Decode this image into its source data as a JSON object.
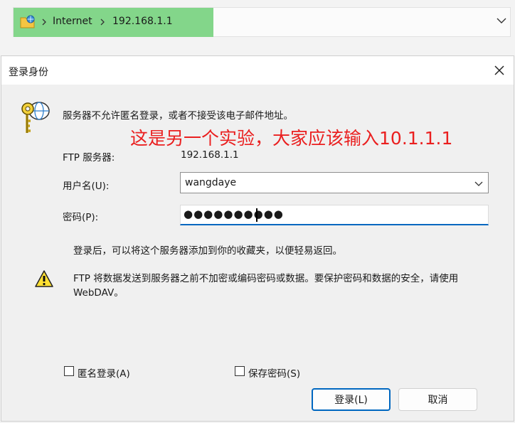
{
  "address_bar": {
    "crumbs": [
      "Internet",
      "192.168.1.1"
    ],
    "highlight_color": "#83d68a"
  },
  "dialog": {
    "title": "登录身份",
    "message": "服务器不允许匿名登录，或者不接受该电子邮件地址。",
    "annotation": "这是另一个实验，大家应该输入10.1.1.1",
    "annotation_color": "#ea1f1f",
    "ftp_server_label": "FTP 服务器:",
    "ftp_server_value": "192.168.1.1",
    "username_label": "用户名(U):",
    "username_value": "wangdaye",
    "password_label": "密码(P):",
    "password_value": "●●●●●●●●●●",
    "info_text": "登录后，可以将这个服务器添加到你的收藏夹，以便轻易返回。",
    "warning_line1": "FTP 将数据发送到服务器之前不加密或编码密码或数据。要保护密码和数据的安全，请使用",
    "warning_line2": "WebDAV。",
    "anonymous_label": "匿名登录(A)",
    "save_password_label": "保存密码(S)",
    "login_button": "登录(L)",
    "cancel_button": "取消",
    "accent_color": "#0067c0",
    "icons": [
      "folder-network-icon",
      "chevron-right-icon",
      "chevron-down-icon",
      "close-icon",
      "key-globe-icon",
      "warning-icon"
    ]
  }
}
